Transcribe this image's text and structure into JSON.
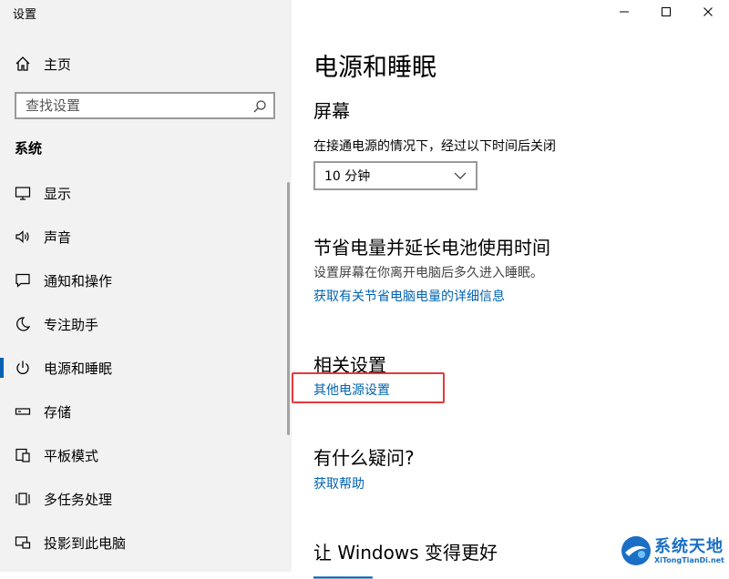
{
  "window": {
    "title": "设置",
    "controls": [
      "minimize-icon",
      "maximize-icon",
      "close-icon"
    ]
  },
  "sidebar": {
    "home_label": "主页",
    "search_placeholder": "查找设置",
    "section_label": "系统",
    "items": [
      {
        "label": "显示",
        "icon": "monitor-icon"
      },
      {
        "label": "声音",
        "icon": "speaker-icon"
      },
      {
        "label": "通知和操作",
        "icon": "notification-icon"
      },
      {
        "label": "专注助手",
        "icon": "moon-icon"
      },
      {
        "label": "电源和睡眠",
        "icon": "power-icon",
        "active": true
      },
      {
        "label": "存储",
        "icon": "storage-icon"
      },
      {
        "label": "平板模式",
        "icon": "tablet-mode-icon"
      },
      {
        "label": "多任务处理",
        "icon": "multitask-icon"
      },
      {
        "label": "投影到此电脑",
        "icon": "project-icon"
      }
    ]
  },
  "main": {
    "title": "电源和睡眠",
    "screen": {
      "heading": "屏幕",
      "label": "在接通电源的情况下，经过以下时间后关闭",
      "dropdown_value": "10 分钟"
    },
    "battery": {
      "heading": "节省电量并延长电池使用时间",
      "description": "设置屏幕在你离开电脑后多久进入睡眠。",
      "link": "获取有关节省电脑电量的详细信息"
    },
    "related": {
      "heading": "相关设置",
      "link": "其他电源设置"
    },
    "question": {
      "heading": "有什么疑问?",
      "link": "获取帮助"
    },
    "improve": {
      "heading": "让 Windows 变得更好"
    }
  },
  "colors": {
    "accent": "#0063b1",
    "highlight": "#e23b3b",
    "sidebar_bg": "#f2f2f2"
  },
  "watermark": {
    "main": "系统天地",
    "sub": "XiTongTianDi.net"
  }
}
